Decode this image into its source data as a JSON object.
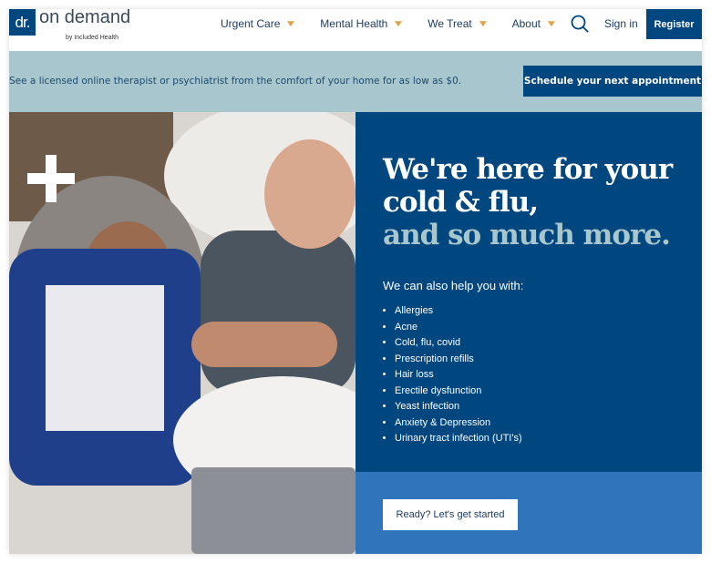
{
  "brand": {
    "mark": "dr.",
    "name": "on demand",
    "sub": "by Included Health"
  },
  "nav": {
    "items": [
      {
        "label": "Urgent Care"
      },
      {
        "label": "Mental Health"
      },
      {
        "label": "We Treat"
      },
      {
        "label": "About"
      }
    ],
    "chevron": "⌄",
    "sign_in": "Sign in",
    "register": "Register"
  },
  "banner": {
    "text": "See a licensed online therapist or psychiatrist from the comfort of your home for as low as $0.",
    "button": "Schedule your next appointment"
  },
  "hero": {
    "line1": "We're here for your",
    "line2": "cold & flu,",
    "line3": "and so much more.",
    "intro": "We can also help you with:",
    "items": [
      "Allergies",
      "Acne",
      "Cold, flu, covid",
      "Prescription refills",
      "Hair loss",
      "Erectile dysfunction",
      "Yeast infection",
      "Anxiety & Depression",
      "Urinary tract infection (UTI's)"
    ],
    "cta": "Ready? Let's get started"
  },
  "colors": {
    "primary": "#00467f",
    "banner": "#a8c6cd",
    "accent": "#e0a54a",
    "cta_panel": "#2e75bb"
  }
}
